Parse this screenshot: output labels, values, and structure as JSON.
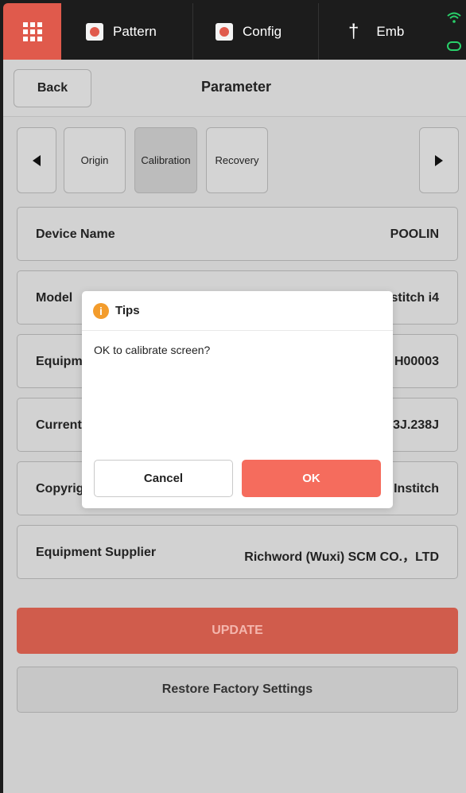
{
  "nav": {
    "tabs": [
      {
        "label": "Pattern",
        "icon": "pattern-icon"
      },
      {
        "label": "Config",
        "icon": "config-icon"
      },
      {
        "label": "Emb",
        "icon": "needle-icon"
      }
    ],
    "accent": "#e05a4c",
    "status_color": "#29d06a"
  },
  "header": {
    "back_label": "Back",
    "title": "Parameter"
  },
  "subtabs": {
    "items": [
      "Origin",
      "Calibration",
      "Recovery"
    ],
    "active": "Calibration"
  },
  "rows": [
    {
      "label": "Device Name",
      "value": "POOLIN"
    },
    {
      "label": "Model",
      "value": "stitch i4"
    },
    {
      "label": "Equipm",
      "value": "H00003"
    },
    {
      "label": "Current",
      "value": "3J.238J"
    },
    {
      "label": "Copyrig",
      "value": "Institch"
    },
    {
      "label": "Equipment Supplier",
      "value": "Richword (Wuxi) SCM CO.，LTD"
    }
  ],
  "actions": {
    "update_label": "UPDATE",
    "restore_label": "Restore Factory Settings"
  },
  "dialog": {
    "title": "Tips",
    "message": "OK to calibrate screen?",
    "cancel_label": "Cancel",
    "ok_label": "OK",
    "ok_color": "#f56c5d"
  }
}
